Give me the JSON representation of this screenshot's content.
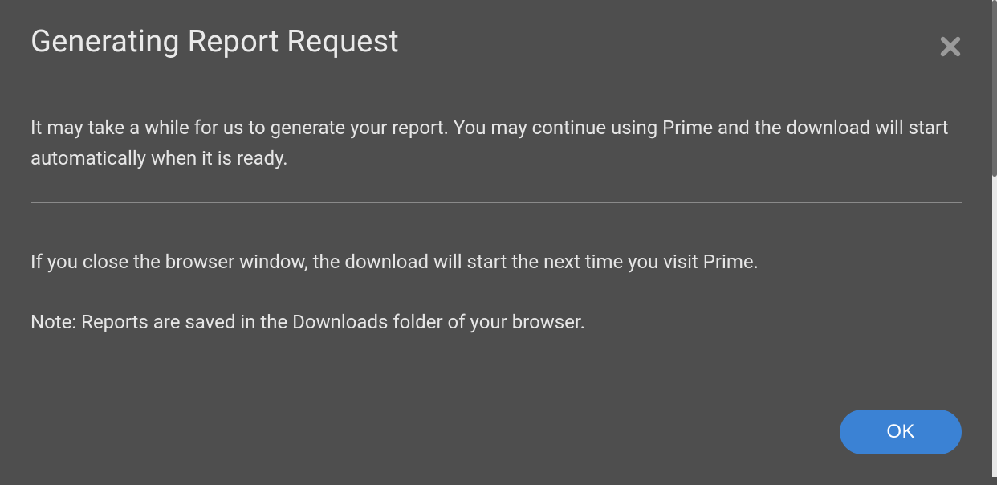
{
  "modal": {
    "title": "Generating Report Request",
    "paragraph1": "It may take a while for us to generate your report. You may continue using Prime and the download will start automatically when it is ready.",
    "paragraph2": "If you close the browser window, the download will start the next time you visit Prime.",
    "paragraph3": "Note: Reports are saved in the Downloads folder of your browser.",
    "ok_label": "OK"
  }
}
